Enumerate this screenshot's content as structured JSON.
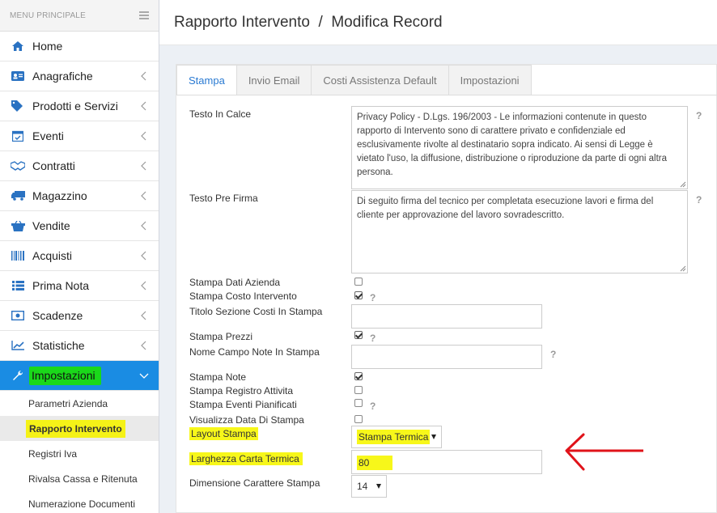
{
  "sidebar": {
    "header_title": "MENU PRINCIPALE",
    "items": [
      {
        "label": "Home",
        "icon": "home-icon",
        "chevron": false
      },
      {
        "label": "Anagrafiche",
        "icon": "address-card-icon",
        "chevron": true
      },
      {
        "label": "Prodotti e Servizi",
        "icon": "tags-icon",
        "chevron": true
      },
      {
        "label": "Eventi",
        "icon": "calendar-check-icon",
        "chevron": true
      },
      {
        "label": "Contratti",
        "icon": "handshake-icon",
        "chevron": true
      },
      {
        "label": "Magazzino",
        "icon": "truck-icon",
        "chevron": true
      },
      {
        "label": "Vendite",
        "icon": "shopping-basket-icon",
        "chevron": true
      },
      {
        "label": "Acquisti",
        "icon": "barcode-icon",
        "chevron": true
      },
      {
        "label": "Prima Nota",
        "icon": "list-icon",
        "chevron": true
      },
      {
        "label": "Scadenze",
        "icon": "money-icon",
        "chevron": true
      },
      {
        "label": "Statistiche",
        "icon": "line-chart-icon",
        "chevron": true
      },
      {
        "label": "Impostazioni",
        "icon": "wrench-icon",
        "chevron": true,
        "active": true
      }
    ],
    "submenu": [
      {
        "label": "Parametri Azienda"
      },
      {
        "label": "Rapporto Intervento",
        "current": true
      },
      {
        "label": "Registri Iva"
      },
      {
        "label": "Rivalsa Cassa e Ritenuta"
      },
      {
        "label": "Numerazione Documenti"
      }
    ]
  },
  "page": {
    "title": "Rapporto Intervento  /  Modifica Record"
  },
  "tabs": [
    {
      "label": "Stampa",
      "active": true
    },
    {
      "label": "Invio Email"
    },
    {
      "label": "Costi Assistenza Default"
    },
    {
      "label": "Impostazioni"
    }
  ],
  "form": {
    "testo_in_calce": {
      "label": "Testo In Calce",
      "value": "Privacy Policy - D.Lgs. 196/2003 - Le informazioni contenute in questo rapporto di Intervento sono di carattere privato e confidenziale ed esclusivamente rivolte al destinatario sopra indicato. Ai sensi di Legge è vietato l'uso, la diffusione, distribuzione o riproduzione da parte di ogni altra persona."
    },
    "testo_pre_firma": {
      "label": "Testo Pre Firma",
      "value": "Di seguito firma del tecnico per completata esecuzione lavori e firma del cliente per approvazione del lavoro sovradescritto."
    },
    "stampa_dati_azienda": {
      "label": "Stampa Dati Azienda",
      "checked": false
    },
    "stampa_costo_intervento": {
      "label": "Stampa Costo Intervento",
      "checked": true
    },
    "titolo_sezione_costi": {
      "label": "Titolo Sezione Costi In Stampa",
      "value": ""
    },
    "stampa_prezzi": {
      "label": "Stampa Prezzi",
      "checked": true
    },
    "nome_campo_note": {
      "label": "Nome Campo Note In Stampa",
      "value": ""
    },
    "stampa_note": {
      "label": "Stampa Note",
      "checked": true
    },
    "stampa_registro_attivita": {
      "label": "Stampa Registro Attivita",
      "checked": false
    },
    "stampa_eventi_pianificati": {
      "label": "Stampa Eventi Pianificati",
      "checked": false
    },
    "visualizza_data_stampa": {
      "label": "Visualizza Data Di Stampa",
      "checked": false
    },
    "layout_stampa": {
      "label": "Layout Stampa",
      "value": "Stampa Termica"
    },
    "larghezza_carta_termica": {
      "label": "Larghezza Carta Termica",
      "value": "80"
    },
    "dimensione_carattere": {
      "label": "Dimensione Carattere Stampa",
      "value": "14"
    },
    "help_glyph": "?"
  },
  "colors": {
    "active_menu_bg": "#1a8ce3",
    "green_highlight": "#1ad81a",
    "yellow_highlight": "#f7f71a",
    "tab_active_text": "#2a7ad2",
    "annotation_arrow": "#e0131a"
  }
}
